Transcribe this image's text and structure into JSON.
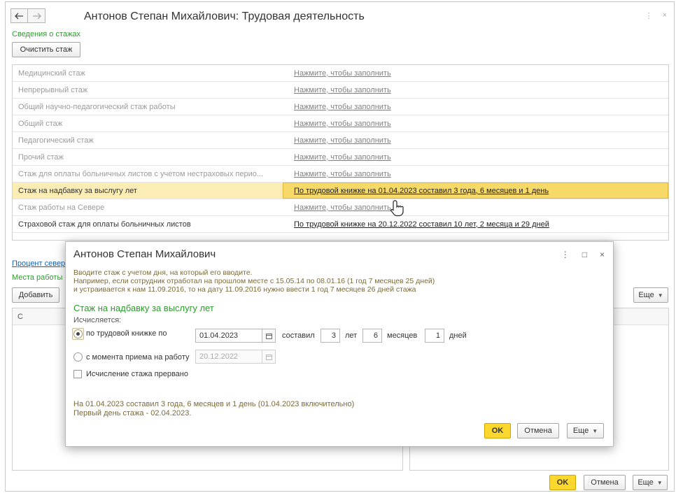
{
  "window": {
    "title": "Антонов Степан Михайлович: Трудовая деятельность",
    "back_icon": "arrow-left-icon",
    "forward_icon": "arrow-right-icon",
    "menu_glyph": "⋮",
    "close_glyph": "×"
  },
  "stazh": {
    "section_label": "Сведения о стажах",
    "clear_button": "Очистить стаж",
    "rows": [
      {
        "name": "Медицинский стаж",
        "value": "Нажмите, чтобы заполнить"
      },
      {
        "name": "Непрерывный стаж",
        "value": "Нажмите, чтобы заполнить"
      },
      {
        "name": "Общий научно-педагогический стаж работы",
        "value": "Нажмите, чтобы заполнить"
      },
      {
        "name": "Общий стаж",
        "value": "Нажмите, чтобы заполнить"
      },
      {
        "name": "Педагогический стаж",
        "value": "Нажмите, чтобы заполнить"
      },
      {
        "name": "Прочий стаж",
        "value": "Нажмите, чтобы заполнить"
      },
      {
        "name": "Стаж для оплаты больничных листов с учетом нестраховых перио...",
        "value": "Нажмите, чтобы заполнить"
      },
      {
        "name": "Стаж на надбавку за выслугу лет",
        "value": "По трудовой книжке на 01.04.2023 составил 3 года, 6 месяцев и 1 день"
      },
      {
        "name": "Стаж работы на Севере",
        "value": "Нажмите, чтобы заполнить"
      },
      {
        "name": "Страховой стаж для оплаты больничных листов",
        "value": "По трудовой книжке на 20.12.2022 составил 10 лет, 2 месяца и 29 дней"
      }
    ]
  },
  "lower": {
    "percent_link": "Процент север",
    "workplaces_label": "Места работы",
    "add_button": "Добавить",
    "more_button": "Еще",
    "column_c": "С"
  },
  "footer": {
    "ok_button": "OK",
    "cancel_button": "Отмена",
    "more_button": "Еще"
  },
  "dialog": {
    "title": "Антонов Степан Михайлович",
    "hint_1": "Вводите стаж с учетом дня, на который его вводите.",
    "hint_2": "Например, если сотрудник отработал на прошлом месте с 15.05.14 по 08.01.16 (1 год 7 месяцев 25 дней)",
    "hint_3": "и устраивается к нам 11.09.2016, то на дату 11.09.2016 нужно ввести 1 год 7 месяцев 26 дней стажа",
    "section": "Стаж на надбавку за выслугу лет",
    "calc_label": "Исчисляется:",
    "option_book": "по трудовой книжке по",
    "date_book": "01.04.2023",
    "composed_label": "составил",
    "years_value": "3",
    "years_label": "лет",
    "months_value": "6",
    "months_label": "месяцев",
    "days_value": "1",
    "days_label": "дней",
    "option_hire": "с момента приема на работу",
    "date_hire": "20.12.2022",
    "interrupted_label": "Исчисление стажа прервано",
    "result_1": "На 01.04.2023 составил 3 года, 6 месяцев и 1 день (01.04.2023 включительно)",
    "result_2": "Первый день стажа - 02.04.2023.",
    "ok_button": "OK",
    "cancel_button": "Отмена",
    "more_button": "Еще",
    "menu_glyph": "⋮",
    "maximize_glyph": "□",
    "close_glyph": "×"
  }
}
